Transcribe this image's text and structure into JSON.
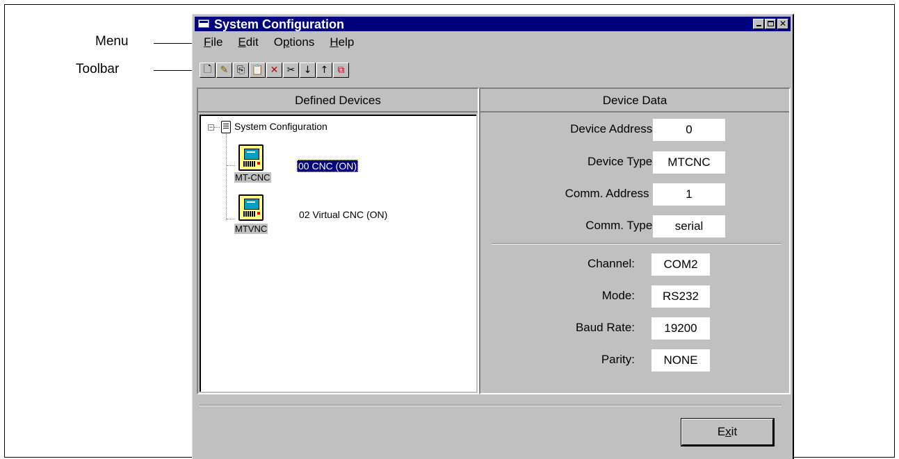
{
  "callouts": {
    "menu": "Menu",
    "toolbar": "Toolbar"
  },
  "window": {
    "title": "System Configuration"
  },
  "menu": [
    {
      "label": "File",
      "hotkey": "F",
      "rest": "ile"
    },
    {
      "label": "Edit",
      "hotkey": "E",
      "rest": "dit"
    },
    {
      "label": "Options",
      "pre": "O",
      "hotkey": "p",
      "rest": "tions"
    },
    {
      "label": "Help",
      "hotkey": "H",
      "rest": "elp"
    }
  ],
  "toolbar": [
    {
      "name": "new-icon",
      "glyph": "🗋"
    },
    {
      "name": "edit-icon",
      "glyph": "✎"
    },
    {
      "name": "copy-icon",
      "glyph": "⎘"
    },
    {
      "name": "paste-icon",
      "glyph": "📋"
    },
    {
      "name": "delete-icon",
      "glyph": "✕"
    },
    {
      "name": "cut-icon",
      "glyph": "✂"
    },
    {
      "name": "move-down-icon",
      "glyph": "↓"
    },
    {
      "name": "move-up-icon",
      "glyph": "↑"
    },
    {
      "name": "network-icon",
      "glyph": "⧉"
    }
  ],
  "left_panel": {
    "header": "Defined Devices",
    "root": {
      "label": "System Configuration"
    },
    "devices": [
      {
        "icon_label": "MT-CNC",
        "label": "00  CNC  (ON)",
        "selected": true
      },
      {
        "icon_label": "MTVNC",
        "label": "02  Virtual CNC  (ON)",
        "selected": false
      }
    ]
  },
  "right_panel": {
    "header": "Device Data",
    "general": [
      {
        "label": "Device Address:",
        "value": "0"
      },
      {
        "label": "Device Type:",
        "value": "MTCNC"
      },
      {
        "label": "Comm. Address :",
        "value": "1"
      },
      {
        "label": "Comm. Type:",
        "value": "serial"
      }
    ],
    "serial": [
      {
        "label": "Channel:",
        "value": "COM2"
      },
      {
        "label": "Mode:",
        "value": "RS232"
      },
      {
        "label": "Baud Rate:",
        "value": "19200"
      },
      {
        "label": "Parity:",
        "value": "NONE"
      }
    ]
  },
  "buttons": {
    "exit": "Exit",
    "exit_hotkey": "x"
  },
  "colors": {
    "titlebar": "#000080",
    "face": "#c0c0c0",
    "selection": "#000080"
  }
}
